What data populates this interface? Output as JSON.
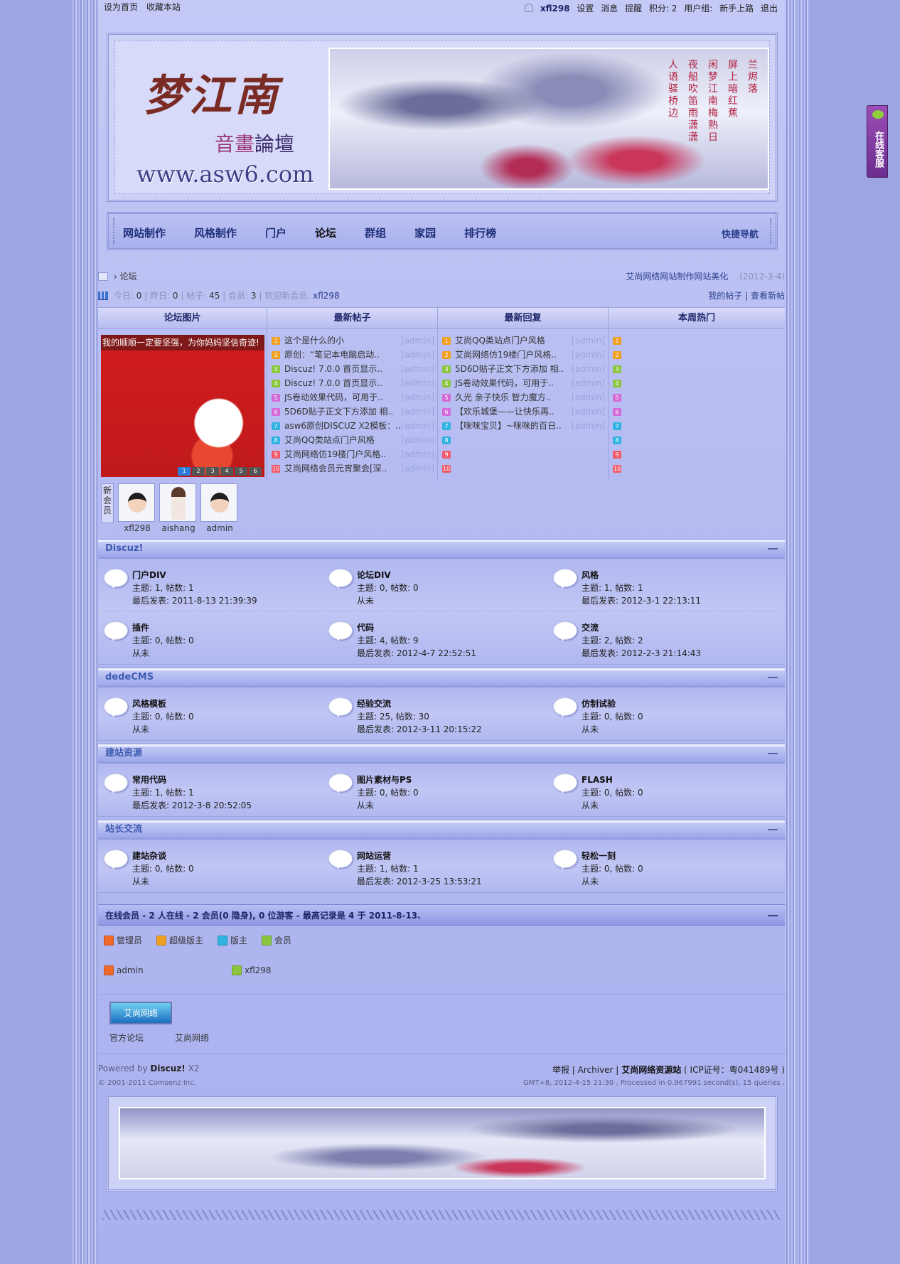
{
  "topbar": {
    "left": [
      "设为首页",
      "收藏本站"
    ],
    "username": "xfl298",
    "links": [
      "设置",
      "消息",
      "提醒",
      "积分: 2",
      "用户组:",
      "新手上路",
      "退出"
    ]
  },
  "header": {
    "logo_main": "梦江南",
    "logo_sub_a": "音畫",
    "logo_sub_b": "論壇",
    "logo_url": "www.asw6.com",
    "poem": [
      "兰烬落",
      "屏上暗红蕉",
      "闲梦江南梅熟日",
      "夜船吹笛雨潇潇",
      "人语驿桥边"
    ]
  },
  "nav": {
    "items": [
      "网站制作",
      "风格制作",
      "门户",
      "论坛",
      "群组",
      "家园",
      "排行榜"
    ],
    "active_index": 3,
    "quick": "快捷导航"
  },
  "breadcrumb": {
    "current": "论坛",
    "right_text": "艾尚网络网站制作网站美化",
    "right_date": "(2012-3-4)"
  },
  "stats": {
    "today_label": "今日:",
    "today": "0",
    "yesterday_label": "昨日:",
    "yesterday": "0",
    "posts_label": "帖子:",
    "posts": "45",
    "members_label": "会员:",
    "members": "3",
    "welcome_label": "欢迎新会员:",
    "welcome_user": "xfl298",
    "my_posts": "我的帖子",
    "view_new": "查看新帖"
  },
  "portal": {
    "headers": [
      "论坛图片",
      "最新帖子",
      "最新回复",
      "本周热门"
    ],
    "pic_caption": "我的顺顺一定要坚强，为你妈妈坚信奇迹!",
    "pic_pages": [
      "1",
      "2",
      "3",
      "4",
      "5",
      "6"
    ],
    "latest_posts": [
      {
        "n": "1",
        "title": "这个是什么的小",
        "author": "[admin]"
      },
      {
        "n": "2",
        "title": "原创：“笔记本电脑启动..",
        "author": "[admin]"
      },
      {
        "n": "3",
        "title": "Discuz! 7.0.0 首页显示..",
        "author": "[admin]"
      },
      {
        "n": "4",
        "title": "Discuz! 7.0.0 首页显示..",
        "author": "[admin]"
      },
      {
        "n": "5",
        "title": "JS卷动效果代码，可用于..",
        "author": "[admin]"
      },
      {
        "n": "6",
        "title": "5D6D贴子正文下方添加 相..",
        "author": "[admin]"
      },
      {
        "n": "7",
        "title": "asw6原创DISCUZ X2模板：..",
        "author": "[admin]"
      },
      {
        "n": "8",
        "title": "艾尚QQ类站点门户风格",
        "author": "[admin]"
      },
      {
        "n": "9",
        "title": "艾尚网络仿19楼门户风格..",
        "author": "[admin]"
      },
      {
        "n": "10",
        "title": "艾尚网络会员元宵聚会[深..",
        "author": "[admin]"
      }
    ],
    "latest_replies": [
      {
        "n": "1",
        "title": "艾尚QQ类站点门户风格",
        "author": "[admin]"
      },
      {
        "n": "2",
        "title": "艾尚网络仿19楼门户风格..",
        "author": "[admin]"
      },
      {
        "n": "3",
        "title": "5D6D贴子正文下方添加 相..",
        "author": "[admin]"
      },
      {
        "n": "4",
        "title": "JS卷动效果代码，可用于..",
        "author": "[admin]"
      },
      {
        "n": "5",
        "title": "久光 亲子快乐 智力魔方..",
        "author": "[admin]"
      },
      {
        "n": "6",
        "title": "【欢乐城堡——让快乐再..",
        "author": "[admin]"
      },
      {
        "n": "7",
        "title": "【咪咪宝贝】~咪咪的百日..",
        "author": "[admin]"
      },
      {
        "n": "8",
        "title": "",
        "author": ""
      },
      {
        "n": "9",
        "title": "",
        "author": ""
      },
      {
        "n": "10",
        "title": "",
        "author": ""
      }
    ],
    "weekly_hot": [
      "1",
      "2",
      "3",
      "4",
      "5",
      "6",
      "7",
      "8",
      "9",
      "10"
    ],
    "num_colors": [
      "#f0a020",
      "#f0a020",
      "#8cc63f",
      "#8cc63f",
      "#d46ad8",
      "#d46ad8",
      "#2fb3e0",
      "#2fb3e0",
      "#f05a6a",
      "#f05a6a"
    ]
  },
  "new_members": {
    "label": "新会员",
    "users": [
      "xfl298",
      "aishang",
      "admin"
    ]
  },
  "categories": [
    {
      "name": "Discuz!",
      "rows": [
        [
          {
            "name": "门户DIV",
            "stats": "主题: 1, 帖数: 1",
            "last": "最后发表: 2011-8-13 21:39:39"
          },
          {
            "name": "论坛DIV",
            "stats": "主题: 0, 帖数: 0",
            "last": "从未"
          },
          {
            "name": "风格",
            "stats": "主题: 1, 帖数: 1",
            "last": "最后发表: 2012-3-1 22:13:11"
          }
        ],
        [
          {
            "name": "插件",
            "stats": "主题: 0, 帖数: 0",
            "last": "从未"
          },
          {
            "name": "代码",
            "stats": "主题: 4, 帖数: 9",
            "last": "最后发表: 2012-4-7 22:52:51"
          },
          {
            "name": "交流",
            "stats": "主题: 2, 帖数: 2",
            "last": "最后发表: 2012-2-3 21:14:43"
          }
        ]
      ]
    },
    {
      "name": "dedeCMS",
      "rows": [
        [
          {
            "name": "风格模板",
            "stats": "主题: 0, 帖数: 0",
            "last": "从未"
          },
          {
            "name": "经验交流",
            "stats": "主题: 25, 帖数: 30",
            "last": "最后发表: 2012-3-11 20:15:22"
          },
          {
            "name": "仿制试验",
            "stats": "主题: 0, 帖数: 0",
            "last": "从未"
          }
        ]
      ]
    },
    {
      "name": "建站资源",
      "rows": [
        [
          {
            "name": "常用代码",
            "stats": "主题: 1, 帖数: 1",
            "last": "最后发表: 2012-3-8 20:52:05"
          },
          {
            "name": "图片素材与PS",
            "stats": "主题: 0, 帖数: 0",
            "last": "从未"
          },
          {
            "name": "FLASH",
            "stats": "主题: 0, 帖数: 0",
            "last": "从未"
          }
        ]
      ]
    },
    {
      "name": "站长交流",
      "rows": [
        [
          {
            "name": "建站杂谈",
            "stats": "主题: 0, 帖数: 0",
            "last": "从未"
          },
          {
            "name": "网站运营",
            "stats": "主题: 1, 帖数: 1",
            "last": "最后发表: 2012-3-25 13:53:21"
          },
          {
            "name": "轻松一刻",
            "stats": "主题: 0, 帖数: 0",
            "last": "从未"
          }
        ]
      ]
    }
  ],
  "online": {
    "title": "在线会员",
    "summary": "- 2 人在线  - 2 会员(0 隐身), 0 位游客  - 最高记录是  4 于  2011-8-13.",
    "legend": [
      {
        "label": "管理员",
        "color": "#f06a2a"
      },
      {
        "label": "超级版主",
        "color": "#f0a020"
      },
      {
        "label": "版主",
        "color": "#2fb3e0"
      },
      {
        "label": "会员",
        "color": "#8cc63f"
      }
    ],
    "users": [
      {
        "name": "admin",
        "color": "#f06a2a"
      },
      {
        "name": "xfl298",
        "color": "#8cc63f"
      }
    ]
  },
  "links": {
    "logo_text": "艾尚网络",
    "items": [
      "官方论坛",
      "艾尚网络"
    ]
  },
  "footer": {
    "powered_prefix": "Powered by",
    "powered_brand": "Discuz!",
    "powered_ver": "X2",
    "copyright": "© 2001-2011 Comsenz Inc.",
    "links_text": "举报 | Archiver |",
    "site_name": "艾尚网络资源站",
    "icp": "( ICP证号：粤041489号 )",
    "process": "GMT+8, 2012-4-15 21:30 , Processed in 0.967991 second(s), 15 queries ."
  },
  "kefu": "在线客服"
}
